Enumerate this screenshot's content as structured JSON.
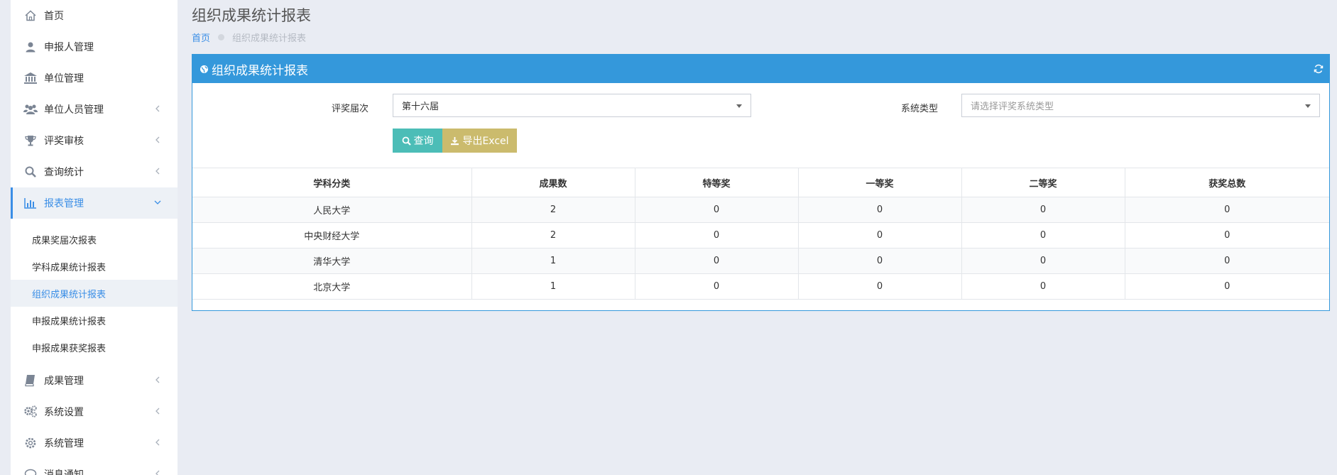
{
  "sidebar": {
    "items": [
      {
        "label": "首页",
        "icon": "home-icon"
      },
      {
        "label": "申报人管理",
        "icon": "user-icon"
      },
      {
        "label": "单位管理",
        "icon": "bank-icon"
      },
      {
        "label": "单位人员管理",
        "icon": "users-icon",
        "chevron": "left"
      },
      {
        "label": "评奖审核",
        "icon": "trophy-icon",
        "chevron": "left"
      },
      {
        "label": "查询统计",
        "icon": "search-icon",
        "chevron": "left"
      },
      {
        "label": "报表管理",
        "icon": "bar-chart-icon",
        "chevron": "down",
        "active": true
      }
    ],
    "submenu": [
      {
        "label": "成果奖届次报表"
      },
      {
        "label": "学科成果统计报表"
      },
      {
        "label": "组织成果统计报表",
        "active": true
      },
      {
        "label": "申报成果统计报表"
      },
      {
        "label": "申报成果获奖报表"
      }
    ],
    "items_after": [
      {
        "label": "成果管理",
        "icon": "book-icon",
        "chevron": "left"
      },
      {
        "label": "系统设置",
        "icon": "cogs-icon",
        "chevron": "left"
      },
      {
        "label": "系统管理",
        "icon": "gear-icon",
        "chevron": "left"
      },
      {
        "label": "消息通知",
        "icon": "message-icon",
        "chevron": "left"
      }
    ]
  },
  "page": {
    "title": "组织成果统计报表",
    "breadcrumb": {
      "home": "首页",
      "current": "组织成果统计报表"
    }
  },
  "panel": {
    "title": "组织成果统计报表"
  },
  "filters": {
    "round_label": "评奖届次",
    "round_value": "第十六届",
    "system_label": "系统类型",
    "system_placeholder": "请选择评奖系统类型"
  },
  "buttons": {
    "query": "查询",
    "export": "导出Excel"
  },
  "table": {
    "headers": [
      "学科分类",
      "成果数",
      "特等奖",
      "一等奖",
      "二等奖",
      "获奖总数"
    ],
    "rows": [
      [
        "人民大学",
        "2",
        "0",
        "0",
        "0",
        "0"
      ],
      [
        "中央财经大学",
        "2",
        "0",
        "0",
        "0",
        "0"
      ],
      [
        "清华大学",
        "1",
        "0",
        "0",
        "0",
        "0"
      ],
      [
        "北京大学",
        "1",
        "0",
        "0",
        "0",
        "0"
      ]
    ]
  },
  "colors": {
    "accent": "#3498db",
    "query_button": "#4cbdb7",
    "export_button": "#cbbb6d",
    "active_link": "#3a8ee6"
  }
}
